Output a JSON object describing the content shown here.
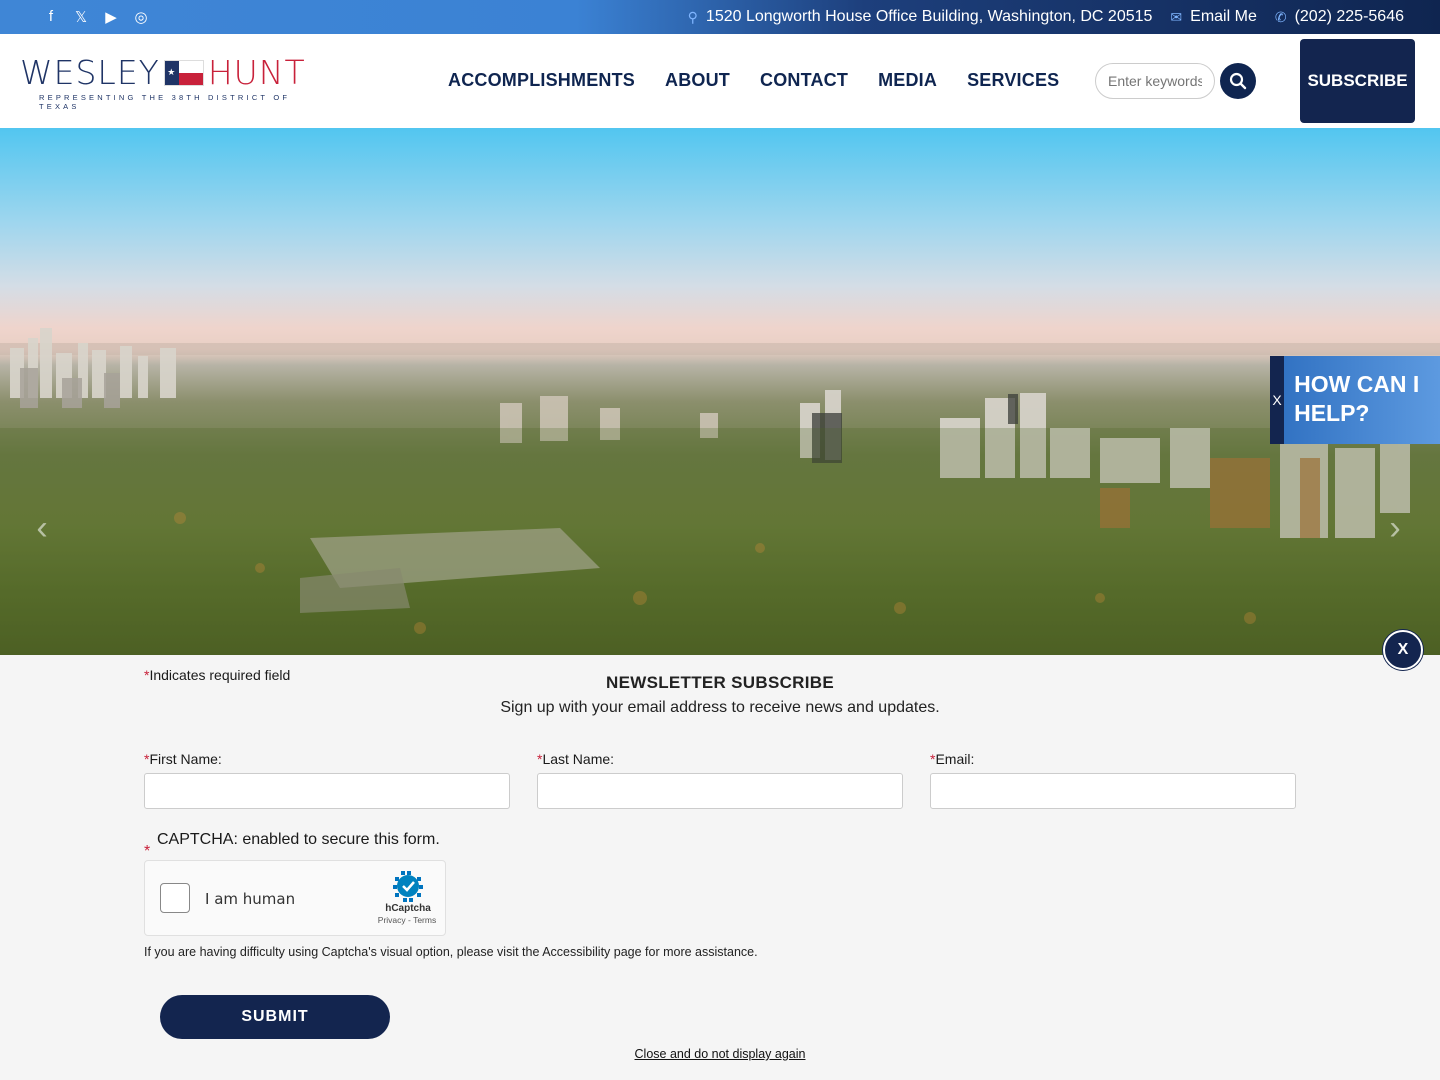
{
  "topbar": {
    "social": [
      {
        "icon": "facebook-icon",
        "glyph": "f"
      },
      {
        "icon": "x-icon",
        "glyph": "𝕏"
      },
      {
        "icon": "youtube-icon",
        "glyph": "▶"
      },
      {
        "icon": "instagram-icon",
        "glyph": "◎"
      }
    ],
    "address": "1520 Longworth House Office Building, Washington, DC 20515",
    "email_label": "Email Me",
    "phone": "(202) 225-5646"
  },
  "header": {
    "logo_wesley": "WESLEY",
    "logo_hunt": "HUNT",
    "logo_tagline": "REPRESENTING THE 38TH DISTRICT OF TEXAS",
    "nav": [
      "ACCOMPLISHMENTS",
      "ABOUT",
      "CONTACT",
      "MEDIA",
      "SERVICES"
    ],
    "search_placeholder": "Enter keywords",
    "subscribe_label": "SUBSCRIBE"
  },
  "help_widget": {
    "close_label": "X",
    "text": "HOW CAN I HELP?"
  },
  "newsletter": {
    "close_label": "X",
    "required_star": "*",
    "required_note": "Indicates required field",
    "title": "NEWSLETTER SUBSCRIBE",
    "subtitle": "Sign up with your email address to receive news and updates.",
    "first_name_label": "First Name:",
    "last_name_label": "Last Name:",
    "email_label": "Email:",
    "captcha_label": "CAPTCHA: enabled to secure this form.",
    "captcha_checkbox_text": "I am human",
    "hcaptcha_name": "hCaptcha",
    "hcaptcha_links": "Privacy - Terms",
    "difficulty_text": "If you are having difficulty using Captcha's visual option, please visit the Accessibility page for more assistance.",
    "submit_label": "SUBMIT",
    "close_link": "Close and do not display again"
  },
  "colors": {
    "navy": "#13254f",
    "red": "#c8213a",
    "topbar_blue": "#3f86d6"
  }
}
